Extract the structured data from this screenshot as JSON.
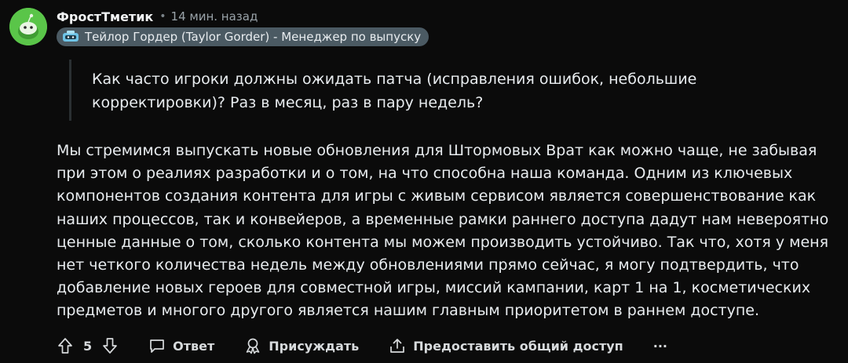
{
  "comment": {
    "author": "ФростТметик",
    "separator": "•",
    "time": "14 мин. назад",
    "flair": "Тейлор Гордер (Taylor Gorder) - Менеджер по выпуску",
    "quote": "Как часто игроки должны ожидать патча (исправления ошибок, небольшие корректировки)? Раз в месяц, раз в пару недель?",
    "body": "Мы стремимся выпускать новые обновления для Штормовых Врат как можно чаще, не забывая при этом о реалиях разработки и о том, на что способна наша команда. Одним из ключевых компонентов создания контента для игры с живым сервисом является совершенствование как наших процессов, так и конвейеров, а временные рамки раннего доступа дадут нам невероятно ценные данные о том, сколько контента мы можем производить устойчиво. Так что, хотя у меня нет четкого количества недель между обновлениями прямо сейчас, я могу подтвердить, что добавление новых героев для совместной игры, миссий кампании, карт 1 на 1, косметических предметов и многого другого является нашим главным приоритетом в раннем доступе."
  },
  "actions": {
    "score": "5",
    "reply_label": "Ответ",
    "award_label": "Присуждать",
    "share_label": "Предоставить общий доступ",
    "more_label": "···"
  },
  "icons": {
    "avatar": "snoo-avatar-icon",
    "flair": "flair-badge-icon",
    "upvote": "upvote-arrow-icon",
    "downvote": "downvote-arrow-icon",
    "reply": "speech-bubble-icon",
    "award": "award-ribbon-icon",
    "share": "share-upload-icon"
  },
  "colors": {
    "background": "#0b0b0b",
    "avatar": "#5ac549",
    "flair_bg": "#4b5a63",
    "text": "#e8ecef",
    "muted": "#9aa3a9"
  }
}
